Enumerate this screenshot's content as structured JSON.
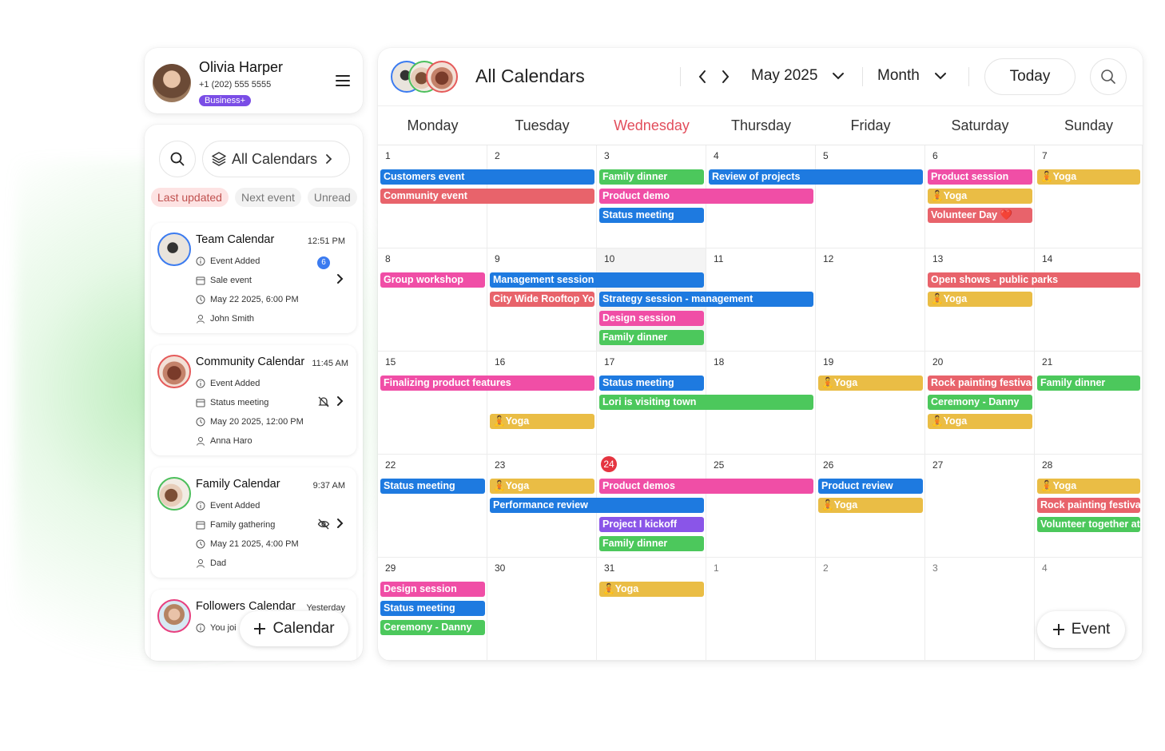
{
  "profile": {
    "name": "Olivia Harper",
    "phone": "+1 (202) 555 5555",
    "badge": "Business+"
  },
  "sidebar": {
    "all_calendars_label": "All Calendars",
    "filters": [
      "Last updated",
      "Next event",
      "Unread"
    ],
    "items": [
      {
        "title": "Team Calendar",
        "time": "12:51 PM",
        "action": "Event Added",
        "event": "Sale event",
        "date": "May 22 2025, 6:00 PM",
        "person": "John Smith",
        "count": "6",
        "ring_color": "#3b7bf0"
      },
      {
        "title": "Community Calendar",
        "time": "11:45 AM",
        "action": "Event Added",
        "event": "Status meeting",
        "date": "May 20 2025, 12:00 PM",
        "person": "Anna Haro",
        "ring_color": "#e55a5a"
      },
      {
        "title": "Family Calendar",
        "time": "9:37 AM",
        "action": "Event Added",
        "event": "Family gathering",
        "date": "May 21 2025, 4:00 PM",
        "person": "Dad",
        "ring_color": "#4cbf5c"
      },
      {
        "title": "Followers Calendar",
        "time": "Yesterday",
        "action": "You joi",
        "ring_color": "#e8407f"
      }
    ],
    "add_calendar_label": "Calendar"
  },
  "calendar": {
    "title": "All Calendars",
    "month": "May 2025",
    "view": "Month",
    "today_label": "Today",
    "add_event_label": "Event",
    "weekdays": [
      "Monday",
      "Tuesday",
      "Wednesday",
      "Thursday",
      "Friday",
      "Saturday",
      "Sunday"
    ],
    "today_weekday_index": 2,
    "weeks": [
      [
        "1",
        "2",
        "3",
        "4",
        "5",
        "6",
        "7"
      ],
      [
        "8",
        "9",
        "10",
        "11",
        "12",
        "13",
        "14"
      ],
      [
        "15",
        "16",
        "17",
        "18",
        "19",
        "20",
        "21"
      ],
      [
        "22",
        "23",
        "24",
        "25",
        "26",
        "27",
        "28"
      ],
      [
        "29",
        "30",
        "31",
        "1",
        "2",
        "3",
        "4"
      ]
    ],
    "colors": {
      "blue": "#1e7ae0",
      "red": "#e8636b",
      "green": "#4cc85c",
      "pink": "#f04ea6",
      "yellow": "#eabd45",
      "purple": "#8a55e8"
    },
    "events": [
      {
        "label": "Customers event",
        "week": 0,
        "start": 0,
        "span": 2,
        "slot": 0,
        "color": "blue"
      },
      {
        "label": "Community event",
        "week": 0,
        "start": 0,
        "span": 2,
        "slot": 1,
        "color": "red"
      },
      {
        "label": "Family dinner",
        "week": 0,
        "start": 2,
        "span": 1,
        "slot": 0,
        "color": "green"
      },
      {
        "label": "Product demo",
        "week": 0,
        "start": 2,
        "span": 2,
        "slot": 1,
        "color": "pink"
      },
      {
        "label": "Status meeting",
        "week": 0,
        "start": 2,
        "span": 1,
        "slot": 2,
        "color": "blue"
      },
      {
        "label": "Review of projects",
        "week": 0,
        "start": 3,
        "span": 2,
        "slot": 0,
        "color": "blue"
      },
      {
        "label": "Product session",
        "week": 0,
        "start": 5,
        "span": 1,
        "slot": 0,
        "color": "pink"
      },
      {
        "label": "🧘Yoga",
        "week": 0,
        "start": 5,
        "span": 1,
        "slot": 1,
        "color": "yellow"
      },
      {
        "label": "Volunteer Day ❤️",
        "week": 0,
        "start": 5,
        "span": 1,
        "slot": 2,
        "color": "red"
      },
      {
        "label": "🧘Yoga",
        "week": 0,
        "start": 6,
        "span": 1,
        "slot": 0,
        "color": "yellow"
      },
      {
        "label": "Group workshop",
        "week": 1,
        "start": 0,
        "span": 1,
        "slot": 0,
        "color": "pink"
      },
      {
        "label": "Management session",
        "week": 1,
        "start": 1,
        "span": 2,
        "slot": 0,
        "color": "blue"
      },
      {
        "label": "City Wide Rooftop Yoga",
        "week": 1,
        "start": 1,
        "span": 1,
        "slot": 1,
        "color": "red"
      },
      {
        "label": "Strategy session - management",
        "week": 1,
        "start": 2,
        "span": 2,
        "slot": 1,
        "color": "blue"
      },
      {
        "label": "Design session",
        "week": 1,
        "start": 2,
        "span": 1,
        "slot": 2,
        "color": "pink"
      },
      {
        "label": "Family dinner",
        "week": 1,
        "start": 2,
        "span": 1,
        "slot": 3,
        "color": "green"
      },
      {
        "label": "Open shows - public parks",
        "week": 1,
        "start": 5,
        "span": 2,
        "slot": 0,
        "color": "red"
      },
      {
        "label": "🧘Yoga",
        "week": 1,
        "start": 5,
        "span": 1,
        "slot": 1,
        "color": "yellow"
      },
      {
        "label": "Finalizing product features",
        "week": 2,
        "start": 0,
        "span": 2,
        "slot": 0,
        "color": "pink"
      },
      {
        "label": "🧘Yoga",
        "week": 2,
        "start": 1,
        "span": 1,
        "slot": 2,
        "color": "yellow"
      },
      {
        "label": "Status meeting",
        "week": 2,
        "start": 2,
        "span": 1,
        "slot": 0,
        "color": "blue"
      },
      {
        "label": "Lori is visiting town",
        "week": 2,
        "start": 2,
        "span": 2,
        "slot": 1,
        "color": "green"
      },
      {
        "label": "🧘Yoga",
        "week": 2,
        "start": 4,
        "span": 1,
        "slot": 0,
        "color": "yellow"
      },
      {
        "label": "Rock painting festival",
        "week": 2,
        "start": 5,
        "span": 1,
        "slot": 0,
        "color": "red"
      },
      {
        "label": "Ceremony - Danny",
        "week": 2,
        "start": 5,
        "span": 1,
        "slot": 1,
        "color": "green"
      },
      {
        "label": "🧘Yoga",
        "week": 2,
        "start": 5,
        "span": 1,
        "slot": 2,
        "color": "yellow"
      },
      {
        "label": "Family dinner",
        "week": 2,
        "start": 6,
        "span": 1,
        "slot": 0,
        "color": "green"
      },
      {
        "label": "Status meeting",
        "week": 3,
        "start": 0,
        "span": 1,
        "slot": 0,
        "color": "blue"
      },
      {
        "label": "🧘Yoga",
        "week": 3,
        "start": 1,
        "span": 1,
        "slot": 0,
        "color": "yellow"
      },
      {
        "label": "Performance review",
        "week": 3,
        "start": 1,
        "span": 2,
        "slot": 1,
        "color": "blue"
      },
      {
        "label": "Product demos",
        "week": 3,
        "start": 2,
        "span": 2,
        "slot": 0,
        "color": "pink"
      },
      {
        "label": "Project I kickoff",
        "week": 3,
        "start": 2,
        "span": 1,
        "slot": 2,
        "color": "purple"
      },
      {
        "label": "Family dinner",
        "week": 3,
        "start": 2,
        "span": 1,
        "slot": 3,
        "color": "green"
      },
      {
        "label": "Product review",
        "week": 3,
        "start": 4,
        "span": 1,
        "slot": 0,
        "color": "blue"
      },
      {
        "label": "🧘Yoga",
        "week": 3,
        "start": 4,
        "span": 1,
        "slot": 1,
        "color": "yellow"
      },
      {
        "label": "🧘Yoga",
        "week": 3,
        "start": 6,
        "span": 1,
        "slot": 0,
        "color": "yellow"
      },
      {
        "label": "Rock painting festival",
        "week": 3,
        "start": 6,
        "span": 1,
        "slot": 1,
        "color": "red"
      },
      {
        "label": "Volunteer together at",
        "week": 3,
        "start": 6,
        "span": 1,
        "slot": 2,
        "color": "green"
      },
      {
        "label": "Design session",
        "week": 4,
        "start": 0,
        "span": 1,
        "slot": 0,
        "color": "pink"
      },
      {
        "label": "Status meeting",
        "week": 4,
        "start": 0,
        "span": 1,
        "slot": 1,
        "color": "blue"
      },
      {
        "label": "Ceremony - Danny",
        "week": 4,
        "start": 0,
        "span": 1,
        "slot": 2,
        "color": "green"
      },
      {
        "label": "🧘Yoga",
        "week": 4,
        "start": 2,
        "span": 1,
        "slot": 0,
        "color": "yellow"
      }
    ]
  }
}
